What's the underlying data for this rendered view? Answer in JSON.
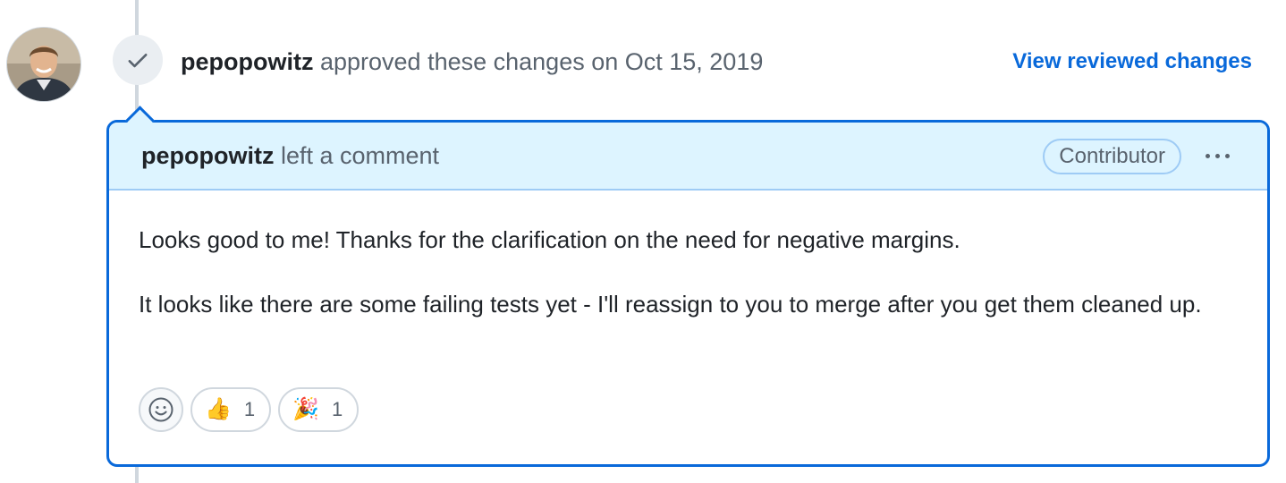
{
  "timeline_event": {
    "author": "pepopowitz",
    "action_text": " approved these changes on Oct 15, 2019",
    "view_link_label": "View reviewed changes",
    "status_icon": "check-icon"
  },
  "comment": {
    "author": "pepopowitz",
    "header_action": " left a comment",
    "role_badge": "Contributor",
    "menu_icon": "kebab-horizontal-icon",
    "paragraphs": [
      "Looks good to me! Thanks for the clarification on the need for negative margins.",
      "It looks like there are some failing tests yet - I'll reassign to you to merge after you get them cleaned up."
    ],
    "reactions": [
      {
        "emoji": "👍",
        "icon": "thumbs-up-icon",
        "count": "1"
      },
      {
        "emoji": "🎉",
        "icon": "tada-icon",
        "count": "1"
      }
    ],
    "add_reaction_icon": "smiley-icon"
  },
  "colors": {
    "accent": "#0969da",
    "header_bg": "#ddf4ff",
    "muted_text": "#59636e"
  }
}
